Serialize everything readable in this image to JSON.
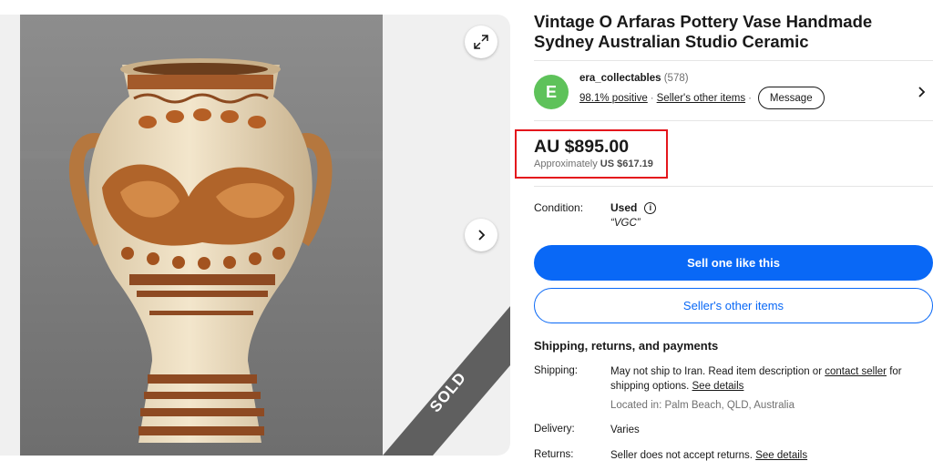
{
  "listing": {
    "title": "Vintage O Arfaras Pottery Vase Handmade Sydney Australian Studio Ceramic",
    "sold_label": "SOLD"
  },
  "gallery": {
    "expand_icon": "expand-arrows-icon",
    "next_icon": "chevron-right-icon"
  },
  "seller": {
    "avatar_letter": "E",
    "avatar_color": "#5ec25a",
    "name": "era_collectables",
    "feedback_count": "(578)",
    "positive": "98.1% positive",
    "separator": "·",
    "other_items_link": "Seller's other items",
    "message_button": "Message"
  },
  "price": {
    "main": "AU $895.00",
    "approx_prefix": "Approximately",
    "approx_value": "US $617.19",
    "highlight_color": "#e4161c"
  },
  "condition": {
    "label": "Condition:",
    "value": "Used",
    "note": "“VGC”"
  },
  "actions": {
    "primary": "Sell one like this",
    "secondary": "Seller's other items",
    "accent_color": "#0968f6"
  },
  "shipping_section": {
    "title": "Shipping, returns, and payments",
    "shipping_label": "Shipping:",
    "shipping_text_1": "May not ship to Iran. Read item description or",
    "contact_seller_link": "contact seller",
    "shipping_text_2": "for shipping options.",
    "see_details_link": "See details",
    "located": "Located in: Palm Beach, QLD, Australia",
    "delivery_label": "Delivery:",
    "delivery_value": "Varies",
    "returns_label": "Returns:",
    "returns_value": "Seller does not accept returns.",
    "returns_link": "See details"
  }
}
